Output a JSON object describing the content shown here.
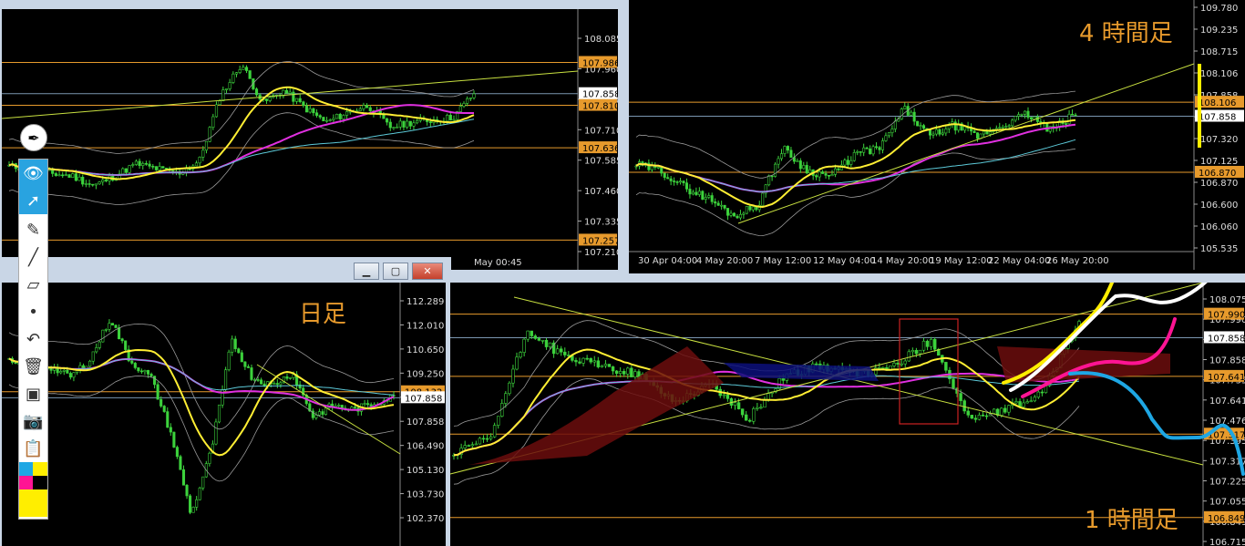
{
  "colors": {
    "bull": "#3cd23c",
    "ma_yellow": "#ffee33",
    "ma_magenta": "#e030e0",
    "ma_cyan": "#5cc9d8",
    "level_orange": "#e79a2c",
    "bb_gray": "#9a9a9a",
    "hl_orange": "#f29c21",
    "hl_pink": "#ff1493",
    "hl_white": "#ffffff",
    "hl_blue": "#1ea7e4",
    "hl_yellow": "#ffee00"
  },
  "toolbar": {
    "icons": [
      "pen-icon",
      "eye-icon",
      "cursor-icon",
      "highlighter-icon",
      "line-icon",
      "eraser-icon",
      "dot-icon",
      "undo-icon",
      "trash-icon",
      "board-icon",
      "camera-icon",
      "clipboard-icon",
      "palette-icon"
    ]
  },
  "panels": {
    "top_left": {
      "axis": [
        "108.085",
        "107.960",
        "107.858",
        "107.710",
        "107.585",
        "107.460",
        "107.335",
        "107.210"
      ],
      "tags": [
        {
          "text": "107.986"
        },
        {
          "text": "107.810"
        },
        {
          "text": "107.636"
        },
        {
          "text": "107.257"
        }
      ],
      "current": "107.858",
      "time_label": "May 00:45"
    },
    "top_right": {
      "label": "4 時間足",
      "axis": [
        "109.780",
        "109.235",
        "108.715",
        "108.106",
        "107.858",
        "107.650",
        "107.320",
        "107.125",
        "106.870",
        "106.600",
        "106.060",
        "105.535"
      ],
      "tags": [
        {
          "text": "108.106"
        },
        {
          "text": "106.870"
        }
      ],
      "current": "107.858",
      "dates": [
        "30 Apr 04:00",
        "4 May 20:00",
        "7 May 12:00",
        "12 May 04:00",
        "14 May 20:00",
        "19 May 12:00",
        "22 May 04:00",
        "26 May 20:00"
      ]
    },
    "bottom_left": {
      "label": "日足",
      "axis": [
        "112.289",
        "112.010",
        "110.650",
        "109.250",
        "108.132",
        "107.858",
        "106.490",
        "105.130",
        "103.730",
        "102.370"
      ],
      "tags": [
        {
          "text": "108.132"
        }
      ],
      "current": "107.858"
    },
    "bottom_right": {
      "label": "1 時間足",
      "axis": [
        "108.075",
        "107.990",
        "107.905",
        "107.858",
        "107.735",
        "107.641",
        "107.476",
        "107.395",
        "107.317",
        "107.225",
        "107.055",
        "106.849",
        "106.715"
      ],
      "tags": [
        {
          "text": "107.990"
        },
        {
          "text": "107.641"
        },
        {
          "text": "107.317"
        },
        {
          "text": "106.849"
        }
      ],
      "current": "107.858"
    }
  },
  "chart_data": [
    {
      "panel": "top_left",
      "type": "line",
      "xlabel": "",
      "ylabel": "",
      "ylim": [
        107.21,
        108.085
      ],
      "levels": [
        107.986,
        107.81,
        107.636,
        107.257
      ],
      "current": 107.858,
      "series": [
        {
          "values": [
            107.56,
            107.55,
            107.53,
            107.52,
            107.48,
            107.52,
            107.57,
            107.55,
            107.53,
            107.58,
            107.85,
            107.98,
            107.82,
            107.87,
            107.8,
            107.74,
            107.78,
            107.81,
            107.72,
            107.74,
            107.75,
            107.76,
            107.86
          ]
        }
      ]
    },
    {
      "panel": "top_right",
      "type": "line",
      "xlabel": "",
      "ylabel": "",
      "ylim": [
        105.535,
        109.78
      ],
      "levels": [
        108.106,
        106.87
      ],
      "current": 107.858,
      "series": [
        {
          "values": [
            107.0,
            106.9,
            106.6,
            106.4,
            106.1,
            106.3,
            107.3,
            106.9,
            106.8,
            107.2,
            107.3,
            108.0,
            107.5,
            107.7,
            107.5,
            107.7,
            107.9,
            107.6,
            107.9
          ]
        }
      ]
    },
    {
      "panel": "bottom_left",
      "type": "line",
      "xlabel": "",
      "ylabel": "",
      "ylim": [
        102.37,
        112.289
      ],
      "levels": [
        108.132
      ],
      "current": 107.858,
      "series": [
        {
          "values": [
            109.5,
            109.0,
            109.3,
            108.8,
            109.6,
            111.5,
            109.5,
            108.8,
            106.2,
            102.5,
            105.5,
            110.5,
            108.8,
            108.4,
            109.0,
            107.0,
            107.5,
            107.3,
            107.6,
            107.9
          ]
        }
      ]
    },
    {
      "panel": "bottom_right",
      "type": "line",
      "xlabel": "",
      "ylabel": "",
      "ylim": [
        106.715,
        108.075
      ],
      "levels": [
        107.99,
        107.641,
        107.317,
        106.849
      ],
      "current": 107.858,
      "series": [
        {
          "values": [
            107.2,
            107.3,
            107.9,
            107.75,
            107.7,
            107.65,
            107.5,
            107.6,
            107.4,
            107.65,
            107.7,
            107.65,
            107.7,
            107.85,
            107.4,
            107.45,
            107.55,
            107.95
          ]
        }
      ]
    }
  ]
}
